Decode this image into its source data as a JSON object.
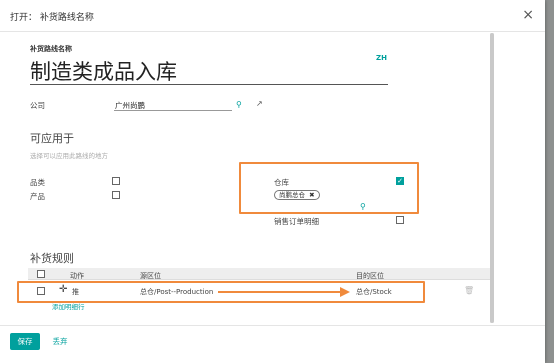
{
  "modal": {
    "title": "打开： 补货路线名称",
    "close": "×"
  },
  "route": {
    "name_label": "补货路线名称",
    "name": "制造类成品入库",
    "lang": "ZH"
  },
  "company": {
    "label": "公司",
    "value": "广州尚鹏"
  },
  "applicable": {
    "title": "可应用于",
    "help": "选择可以应用此路线的地方",
    "product_category": "品类",
    "product": "产品",
    "warehouse": "仓库",
    "warehouse_tag": "尚鹏总仓",
    "sale_line": "销售订单明细"
  },
  "rules": {
    "title": "补货规则",
    "columns": {
      "action": "动作",
      "source": "源区位",
      "dest": "目的区位"
    },
    "rows": [
      {
        "action": "推",
        "source": "总仓/Post--Production",
        "dest": "总仓/Stock"
      }
    ],
    "add_line": "添加明细行"
  },
  "footer": {
    "save": "保存",
    "discard": "丢弃"
  },
  "colors": {
    "accent": "#00A09D",
    "highlight": "#F08A3C"
  }
}
